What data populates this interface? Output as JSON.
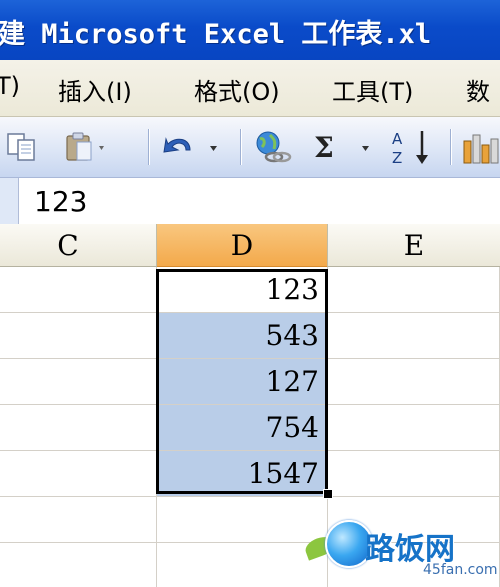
{
  "window": {
    "title": "建 Microsoft Excel 工作表.xl"
  },
  "menu": {
    "items": [
      {
        "label": "T)"
      },
      {
        "label": "插入(I)"
      },
      {
        "label": "格式(O)"
      },
      {
        "label": "工具(T)"
      },
      {
        "label": "数"
      }
    ]
  },
  "toolbar": {
    "icons": [
      "copy-icon",
      "paste-icon",
      "undo-icon",
      "hyperlink-icon",
      "autosum-icon",
      "sort-ascending-icon",
      "chart-icon"
    ]
  },
  "formula_bar": {
    "value": "123"
  },
  "columns": [
    {
      "label": "C",
      "active": false
    },
    {
      "label": "D",
      "active": true
    },
    {
      "label": "E",
      "active": false
    }
  ],
  "cells_d": [
    "123",
    "543",
    "127",
    "754",
    "1547"
  ],
  "colors": {
    "title_bar": "#0a4bc9",
    "selection": "#b9cde8",
    "active_header": "#f3a94b"
  },
  "watermark": {
    "text": "路饭网",
    "sub": "45fan.com"
  }
}
